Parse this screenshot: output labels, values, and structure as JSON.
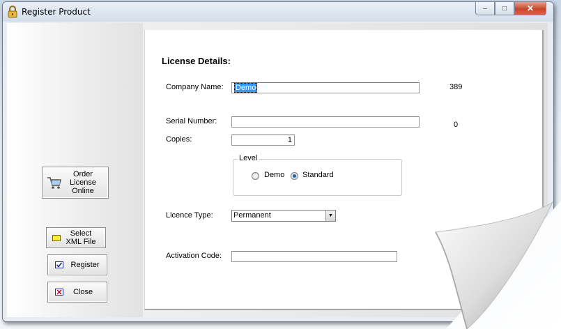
{
  "window": {
    "title": "Register Product",
    "minimize_label": "–",
    "maximize_label": "□",
    "close_label": "✕"
  },
  "sidebar": {
    "order_button": {
      "label": "Order License Online",
      "icon": "cart-icon"
    },
    "select_xml_button": {
      "label": "Select XML File",
      "icon": "folder-icon"
    },
    "register_button": {
      "label": "Register",
      "icon": "checkbox-icon"
    },
    "close_button": {
      "label": "Close",
      "icon": "close-icon"
    }
  },
  "form": {
    "heading": "License Details:",
    "company_name": {
      "label": "Company Name:",
      "value": "Demo",
      "count": "389"
    },
    "serial_number": {
      "label": "Serial Number:",
      "value": "",
      "count": "0"
    },
    "copies": {
      "label": "Copies:",
      "value": "1"
    },
    "level": {
      "legend": "Level",
      "options": [
        {
          "label": "Demo",
          "selected": false
        },
        {
          "label": "Standard",
          "selected": true
        }
      ]
    },
    "licence_type": {
      "label": "Licence Type:",
      "value": "Permanent"
    },
    "activation_code": {
      "label": "Activation Code:",
      "value": ""
    }
  }
}
